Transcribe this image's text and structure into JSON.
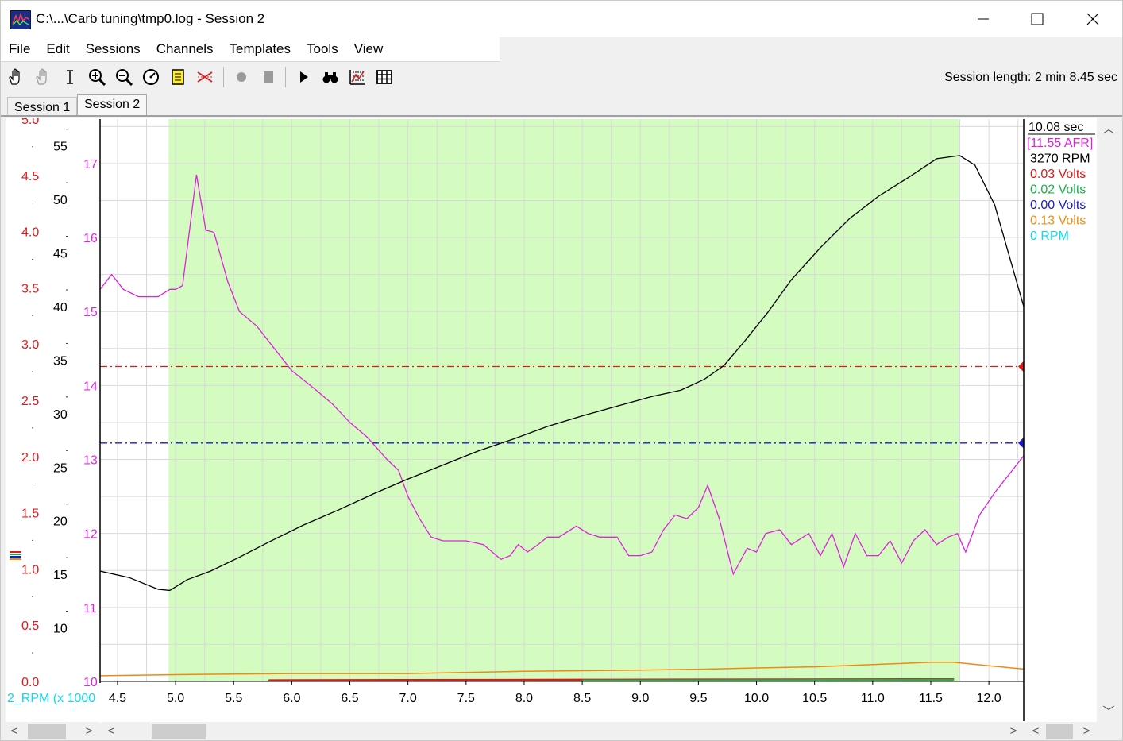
{
  "window": {
    "title": "C:\\...\\Carb tuning\\tmp0.log - Session 2",
    "minimize_glyph": "—",
    "maximize_glyph": "☐",
    "close_glyph": "✕"
  },
  "menu": [
    "File",
    "Edit",
    "Sessions",
    "Channels",
    "Templates",
    "Tools",
    "View"
  ],
  "toolbar": {
    "icons": [
      "hand-pan-icon",
      "hand-disabled-icon",
      "text-cursor-icon",
      "zoom-in-icon",
      "zoom-out-icon",
      "gauge-icon",
      "notes-icon",
      "cross-lines-icon",
      "record-icon",
      "stop-icon",
      "play-icon",
      "binoculars-icon",
      "chart-settings-icon",
      "table-icon"
    ],
    "session_length": "Session length:  2 min 8.45 sec"
  },
  "tabs": [
    {
      "label": "Session 1",
      "active": false
    },
    {
      "label": "Session 2",
      "active": true
    }
  ],
  "colors": {
    "afr": "#dd22dd",
    "rpm": "#000000",
    "red": "#e01818",
    "green": "#1ab04a",
    "blue": "#1a1acc",
    "orange": "#f08a10",
    "cyan": "#10d8f0",
    "highlight": "#d4fcc0",
    "grid": "#d9d9d9"
  },
  "chart_data": {
    "type": "line",
    "x_range": [
      4.35,
      12.3
    ],
    "x_ticks": [
      "4.5",
      "5.0",
      "5.5",
      "6.0",
      "6.5",
      "7.0",
      "7.5",
      "8.0",
      "8.5",
      "9.0",
      "9.5",
      "10.0",
      "10.5",
      "11.0",
      "11.5",
      "12.0"
    ],
    "x_tick_values": [
      4.5,
      5.0,
      5.5,
      6.0,
      6.5,
      7.0,
      7.5,
      8.0,
      8.5,
      9.0,
      9.5,
      10.0,
      10.5,
      11.0,
      11.5,
      12.0
    ],
    "highlight_range": [
      4.94,
      11.74
    ],
    "axes": {
      "volts": {
        "range": [
          0,
          5.0
        ],
        "ticks": [
          "5.0",
          "4.5",
          "4.0",
          "3.5",
          "3.0",
          "2.5",
          "2.0",
          "1.5",
          "1.0",
          "0.5",
          "0.0"
        ],
        "tick_values": [
          5.0,
          4.5,
          4.0,
          3.5,
          3.0,
          2.5,
          2.0,
          1.5,
          1.0,
          0.5,
          0.0
        ]
      },
      "rpm_x100": {
        "range": [
          5,
          57.5
        ],
        "ticks": [
          "55",
          "50",
          "45",
          "40",
          "35",
          "30",
          "25",
          "20",
          "15",
          "10"
        ],
        "tick_values": [
          55,
          50,
          45,
          40,
          35,
          30,
          25,
          20,
          15,
          10
        ]
      },
      "afr": {
        "range": [
          10,
          17.6
        ],
        "ticks": [
          "17",
          "16",
          "15",
          "14",
          "13",
          "12",
          "11",
          "10"
        ],
        "tick_values": [
          17,
          16,
          15,
          14,
          13,
          12,
          11,
          10
        ]
      }
    },
    "bottom_axis_label": "2_RPM (x 1000",
    "reference_lines": [
      {
        "name": "red",
        "volts": 2.8
      },
      {
        "name": "blue",
        "volts": 2.12
      }
    ],
    "series": [
      {
        "key": "afr",
        "axis": "afr",
        "x": [
          4.35,
          4.45,
          4.55,
          4.68,
          4.85,
          4.95,
          5.0,
          5.06,
          5.18,
          5.26,
          5.33,
          5.45,
          5.55,
          5.7,
          5.85,
          6.0,
          6.2,
          6.35,
          6.5,
          6.65,
          6.82,
          6.92,
          7.0,
          7.1,
          7.2,
          7.3,
          7.4,
          7.5,
          7.65,
          7.8,
          7.88,
          7.95,
          8.03,
          8.12,
          8.2,
          8.3,
          8.45,
          8.55,
          8.65,
          8.8,
          8.9,
          9.0,
          9.1,
          9.2,
          9.3,
          9.4,
          9.5,
          9.58,
          9.68,
          9.8,
          9.92,
          10.0,
          10.08,
          10.2,
          10.3,
          10.45,
          10.55,
          10.65,
          10.75,
          10.85,
          10.95,
          11.05,
          11.15,
          11.25,
          11.35,
          11.45,
          11.55,
          11.65,
          11.73,
          11.8,
          11.92,
          12.05,
          12.2,
          12.3
        ],
        "values": [
          15.3,
          15.5,
          15.3,
          15.2,
          15.2,
          15.3,
          15.3,
          15.35,
          16.85,
          16.1,
          16.07,
          15.4,
          15.0,
          14.8,
          14.5,
          14.2,
          13.95,
          13.75,
          13.5,
          13.3,
          13.0,
          12.85,
          12.5,
          12.2,
          11.95,
          11.9,
          11.9,
          11.9,
          11.85,
          11.65,
          11.7,
          11.85,
          11.75,
          11.85,
          11.95,
          11.95,
          12.1,
          12.0,
          11.95,
          11.95,
          11.7,
          11.7,
          11.75,
          12.05,
          12.25,
          12.2,
          12.35,
          12.65,
          12.2,
          11.45,
          11.8,
          11.75,
          12.0,
          12.05,
          11.85,
          12.0,
          11.7,
          12.0,
          11.55,
          12.0,
          11.7,
          11.7,
          11.9,
          11.6,
          11.9,
          12.05,
          11.85,
          11.95,
          12.0,
          11.75,
          12.25,
          12.55,
          12.85,
          13.05
        ]
      },
      {
        "key": "rpm",
        "axis": "rpm_x100",
        "x": [
          4.35,
          4.6,
          4.85,
          4.95,
          5.1,
          5.3,
          5.55,
          5.8,
          6.1,
          6.4,
          6.7,
          7.0,
          7.3,
          7.6,
          7.9,
          8.2,
          8.5,
          8.8,
          9.1,
          9.35,
          9.55,
          9.72,
          9.9,
          10.1,
          10.3,
          10.55,
          10.8,
          11.05,
          11.3,
          11.55,
          11.75,
          11.88,
          12.05,
          12.3
        ],
        "values": [
          15.3,
          14.7,
          13.6,
          13.5,
          14.5,
          15.3,
          16.6,
          18.0,
          19.6,
          21.0,
          22.5,
          23.9,
          25.2,
          26.5,
          27.6,
          28.8,
          29.8,
          30.7,
          31.6,
          32.2,
          33.2,
          34.5,
          36.8,
          39.5,
          42.5,
          45.5,
          48.2,
          50.3,
          52.0,
          53.8,
          54.1,
          53.2,
          49.5,
          40.0
        ]
      },
      {
        "key": "orange",
        "axis": "volts",
        "x": [
          4.35,
          5.0,
          6.0,
          7.0,
          8.0,
          9.0,
          9.6,
          10.0,
          10.5,
          11.0,
          11.5,
          11.7,
          12.0,
          12.3
        ],
        "values": [
          0.05,
          0.06,
          0.07,
          0.07,
          0.09,
          0.1,
          0.11,
          0.12,
          0.13,
          0.15,
          0.17,
          0.17,
          0.14,
          0.11
        ]
      },
      {
        "key": "red",
        "axis": "volts",
        "x": [
          5.8,
          8.5,
          11.7
        ],
        "values": [
          0.01,
          0.015,
          0.02
        ]
      },
      {
        "key": "green",
        "axis": "volts",
        "x": [
          8.5,
          10.5,
          11.7
        ],
        "values": [
          0.008,
          0.012,
          0.015
        ]
      }
    ]
  },
  "readout": {
    "time": "10.08 sec",
    "afr": "[11.55 AFR]",
    "rpm": "3270 RPM",
    "red": "0.03 Volts",
    "green": "0.02 Volts",
    "blue": "0.00 Volts",
    "orange": "0.13 Volts",
    "cyan": "0 RPM"
  },
  "scrollbar": {
    "left_glyph": "<",
    "right_glyph": ">",
    "up_glyph": "︿",
    "down_glyph": "﹀"
  }
}
